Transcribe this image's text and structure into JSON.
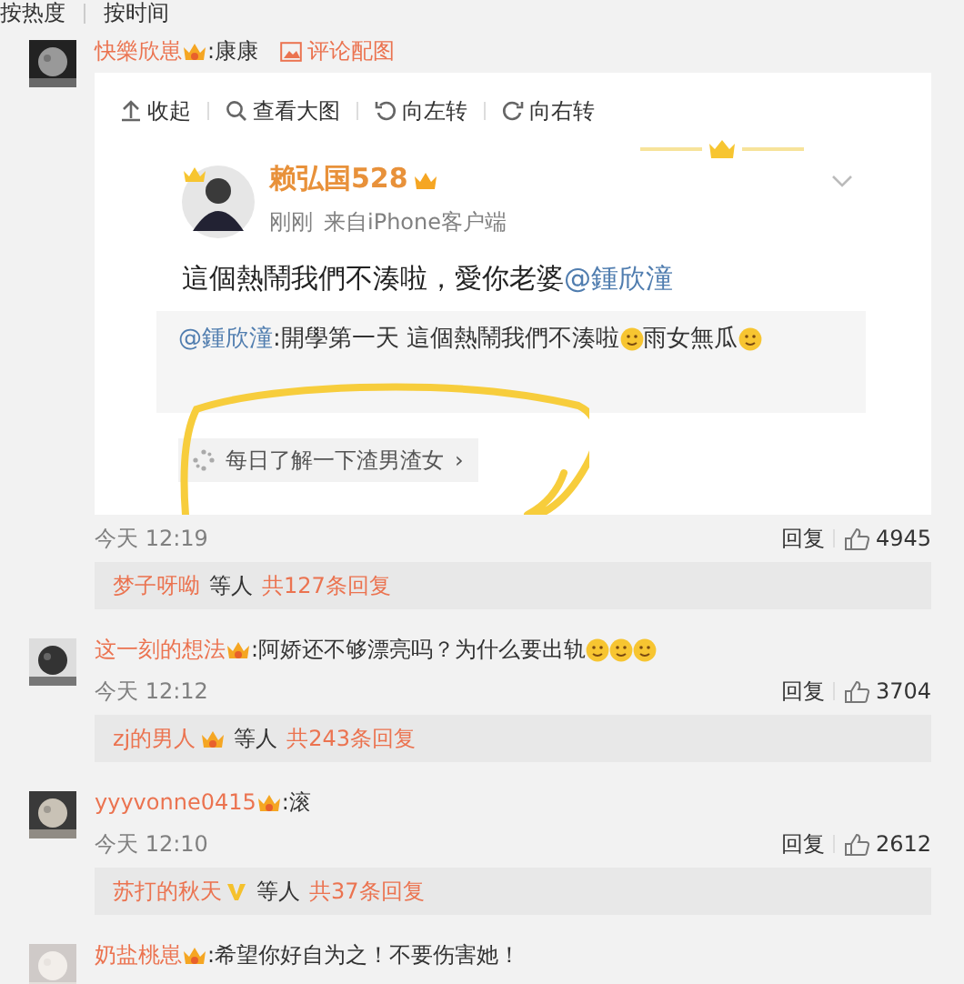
{
  "sort_tabs": [
    {
      "label": "按热度"
    },
    {
      "label": "按时间"
    }
  ],
  "comments": [
    {
      "user": "快樂欣崽",
      "badge": {
        "kind": "vip"
      },
      "segments": [
        {
          "kind": "text",
          "text": ":康康"
        }
      ],
      "image_link": "评论配图",
      "image": {
        "toolbar": [
          {
            "kind": "collapse",
            "label": "收起"
          },
          {
            "kind": "zoom",
            "label": "查看大图"
          },
          {
            "kind": "rotate-left",
            "label": "向左转"
          },
          {
            "kind": "rotate-right",
            "label": "向右转"
          }
        ],
        "post": {
          "author": "赖弘国528",
          "time": "刚刚",
          "source": "来自iPhone客户端",
          "segments": [
            {
              "kind": "text",
              "text": "這個熱鬧我們不湊啦，愛你老婆"
            },
            {
              "kind": "mention",
              "text": "@鍾欣潼"
            }
          ],
          "repost": [
            {
              "kind": "mention",
              "text": "@鍾欣潼"
            },
            {
              "kind": "text",
              "text": ":開學第一天 這個熱鬧我們不湊啦"
            },
            {
              "kind": "emoji"
            },
            {
              "kind": "text",
              "text": " 雨女無瓜"
            },
            {
              "kind": "emoji"
            }
          ],
          "card": "每日了解一下渣男渣女",
          "card_arrow": "›"
        }
      },
      "time": "今天 12:19",
      "reply": "回复",
      "likes": "4945",
      "replies": {
        "user": "梦子呀呦",
        "others": "等人",
        "total": "共127条回复"
      }
    },
    {
      "user": "这一刻的想法",
      "badge": {
        "kind": "vip"
      },
      "segments": [
        {
          "kind": "text",
          "text": ":阿娇还不够漂亮吗？为什么要出轨"
        },
        {
          "kind": "emoji"
        },
        {
          "kind": "emoji"
        },
        {
          "kind": "emoji"
        }
      ],
      "time": "今天 12:12",
      "reply": "回复",
      "likes": "3704",
      "replies": {
        "user": "zj的男人",
        "badge": {
          "kind": "vip"
        },
        "others": "等人",
        "total": "共243条回复"
      }
    },
    {
      "user": "yyyvonne0415",
      "badge": {
        "kind": "vip"
      },
      "segments": [
        {
          "kind": "text",
          "text": ":滚"
        }
      ],
      "time": "今天 12:10",
      "reply": "回复",
      "likes": "2612",
      "replies": {
        "user": "苏打的秋天",
        "badge": {
          "kind": "v"
        },
        "others": "等人",
        "total": "共37条回复"
      }
    },
    {
      "user": "奶盐桃崽",
      "badge": {
        "kind": "vip"
      },
      "segments": [
        {
          "kind": "text",
          "text": ":希望你好自为之！不要伤害她！"
        }
      ]
    }
  ]
}
